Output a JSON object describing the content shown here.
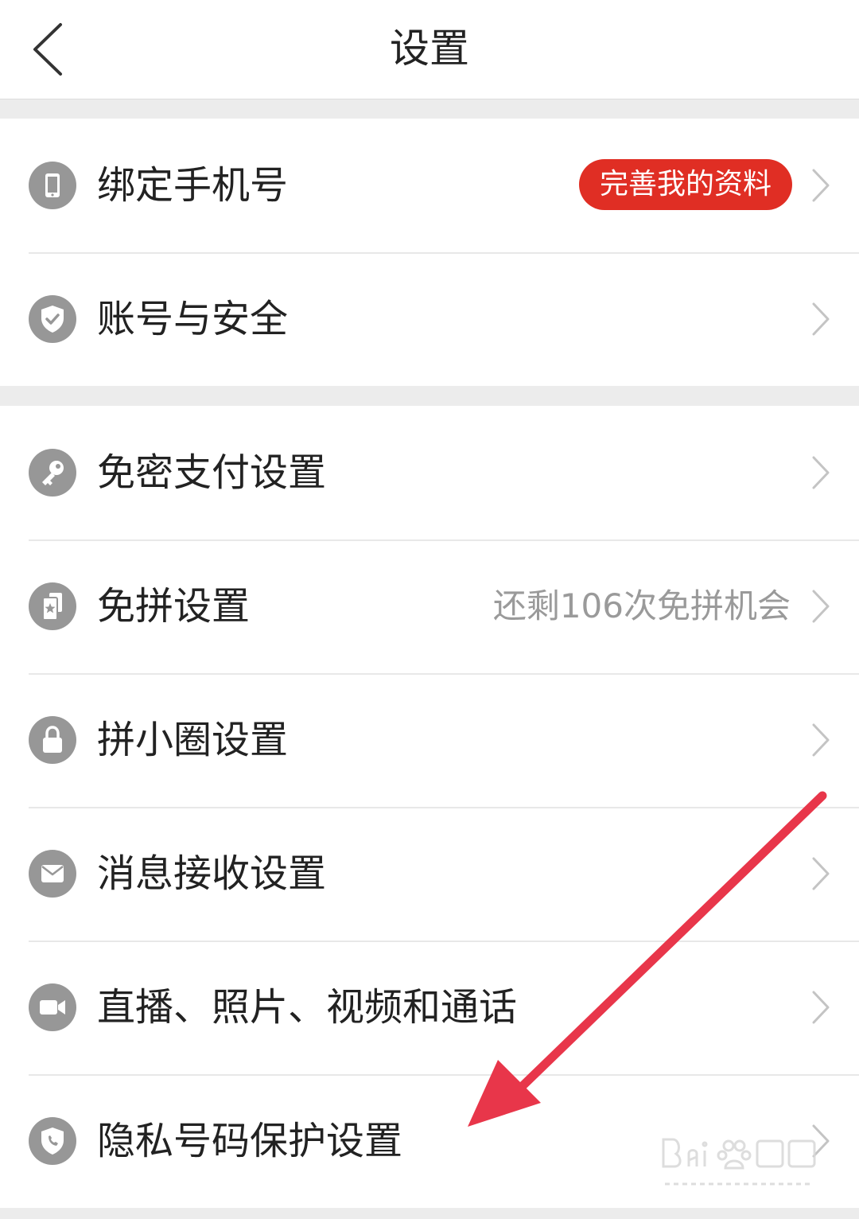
{
  "header": {
    "title": "设置",
    "back_icon": "chevron-left-icon"
  },
  "groups": [
    {
      "items": [
        {
          "label": "绑定手机号",
          "icon": "phone-icon",
          "badge": "完善我的资料"
        },
        {
          "label": "账号与安全",
          "icon": "shield-check-icon"
        }
      ]
    },
    {
      "items": [
        {
          "label": "免密支付设置",
          "icon": "key-icon"
        },
        {
          "label": "免拼设置",
          "icon": "star-card-icon",
          "hint": "还剩106次免拼机会"
        },
        {
          "label": "拼小圈设置",
          "icon": "lock-icon"
        },
        {
          "label": "消息接收设置",
          "icon": "mail-icon"
        },
        {
          "label": "直播、照片、视频和通话",
          "icon": "video-camera-icon"
        },
        {
          "label": "隐私号码保护设置",
          "icon": "shield-phone-icon"
        }
      ]
    }
  ],
  "colors": {
    "accent": "#e02e24",
    "icon_gray": "#979797",
    "annotation_arrow": "#e8364a",
    "page_bg": "#ececec"
  }
}
